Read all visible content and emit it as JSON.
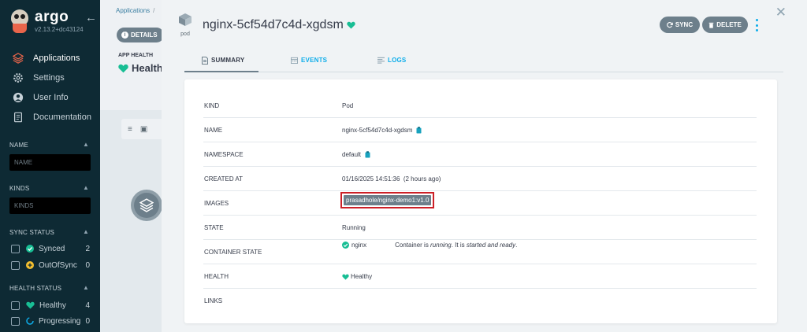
{
  "sidebar": {
    "logo_name": "argo",
    "version": "v2.13.2+dc43124",
    "nav": [
      {
        "label": "Applications",
        "icon": "layers-icon",
        "active": true
      },
      {
        "label": "Settings",
        "icon": "gear-icon",
        "active": false
      },
      {
        "label": "User Info",
        "icon": "user-icon",
        "active": false
      },
      {
        "label": "Documentation",
        "icon": "docs-icon",
        "active": false
      }
    ],
    "filters": {
      "name": {
        "title": "NAME",
        "placeholder": "NAME"
      },
      "kinds": {
        "title": "KINDS",
        "placeholder": "KINDS"
      },
      "sync_status": {
        "title": "SYNC STATUS",
        "items": [
          {
            "label": "Synced",
            "count": "2",
            "icon": "synced-check-icon",
            "color": "#18be94"
          },
          {
            "label": "OutOfSync",
            "count": "0",
            "icon": "out-of-sync-icon",
            "color": "#f4c030"
          }
        ]
      },
      "health_status": {
        "title": "HEALTH STATUS",
        "items": [
          {
            "label": "Healthy",
            "count": "4",
            "icon": "heart-icon",
            "color": "#18be94"
          },
          {
            "label": "Progressing",
            "count": "0",
            "icon": "progress-circle-icon",
            "color": "#0dadea"
          }
        ]
      }
    }
  },
  "background": {
    "breadcrumb": "Applications",
    "breadcrumb_sep": "/",
    "details_label": "DETAILS",
    "app_health_label": "APP HEALTH",
    "app_health_value": "Healthy"
  },
  "panel": {
    "resource_kind_label": "pod",
    "title": "nginx-5cf54d7c4d-xgdsm",
    "sync_label": "SYNC",
    "delete_label": "DELETE",
    "tabs": [
      {
        "label": "SUMMARY",
        "icon": "summary-icon",
        "active": true
      },
      {
        "label": "EVENTS",
        "icon": "calendar-icon",
        "active": false
      },
      {
        "label": "LOGS",
        "icon": "logs-icon",
        "active": false
      }
    ],
    "summary": {
      "kind": {
        "key": "KIND",
        "value": "Pod"
      },
      "name": {
        "key": "NAME",
        "value": "nginx-5cf54d7c4d-xgdsm"
      },
      "namespace": {
        "key": "NAMESPACE",
        "value": "default"
      },
      "created_at": {
        "key": "CREATED AT",
        "value": "01/16/2025 14:51:36  (2 hours ago)"
      },
      "images": {
        "key": "IMAGES",
        "value": "prasadhole/nginx-demo1:v1.0"
      },
      "state": {
        "key": "STATE",
        "value": "Running"
      },
      "container_state": {
        "key": "CONTAINER STATE",
        "container": "nginx",
        "desc_prefix": "Container is ",
        "desc_running": "running",
        "desc_mid": ". It is ",
        "desc_started": "started and ready",
        "desc_suffix": "."
      },
      "health": {
        "key": "HEALTH",
        "value": "Healthy"
      },
      "links": {
        "key": "LINKS",
        "value": ""
      }
    }
  },
  "colors": {
    "sidebar_bg": "#0e2a34",
    "accent": "#0dadea",
    "healthy": "#18be94",
    "button_gray": "#6d7f8b",
    "highlight_red": "#cc2027"
  }
}
